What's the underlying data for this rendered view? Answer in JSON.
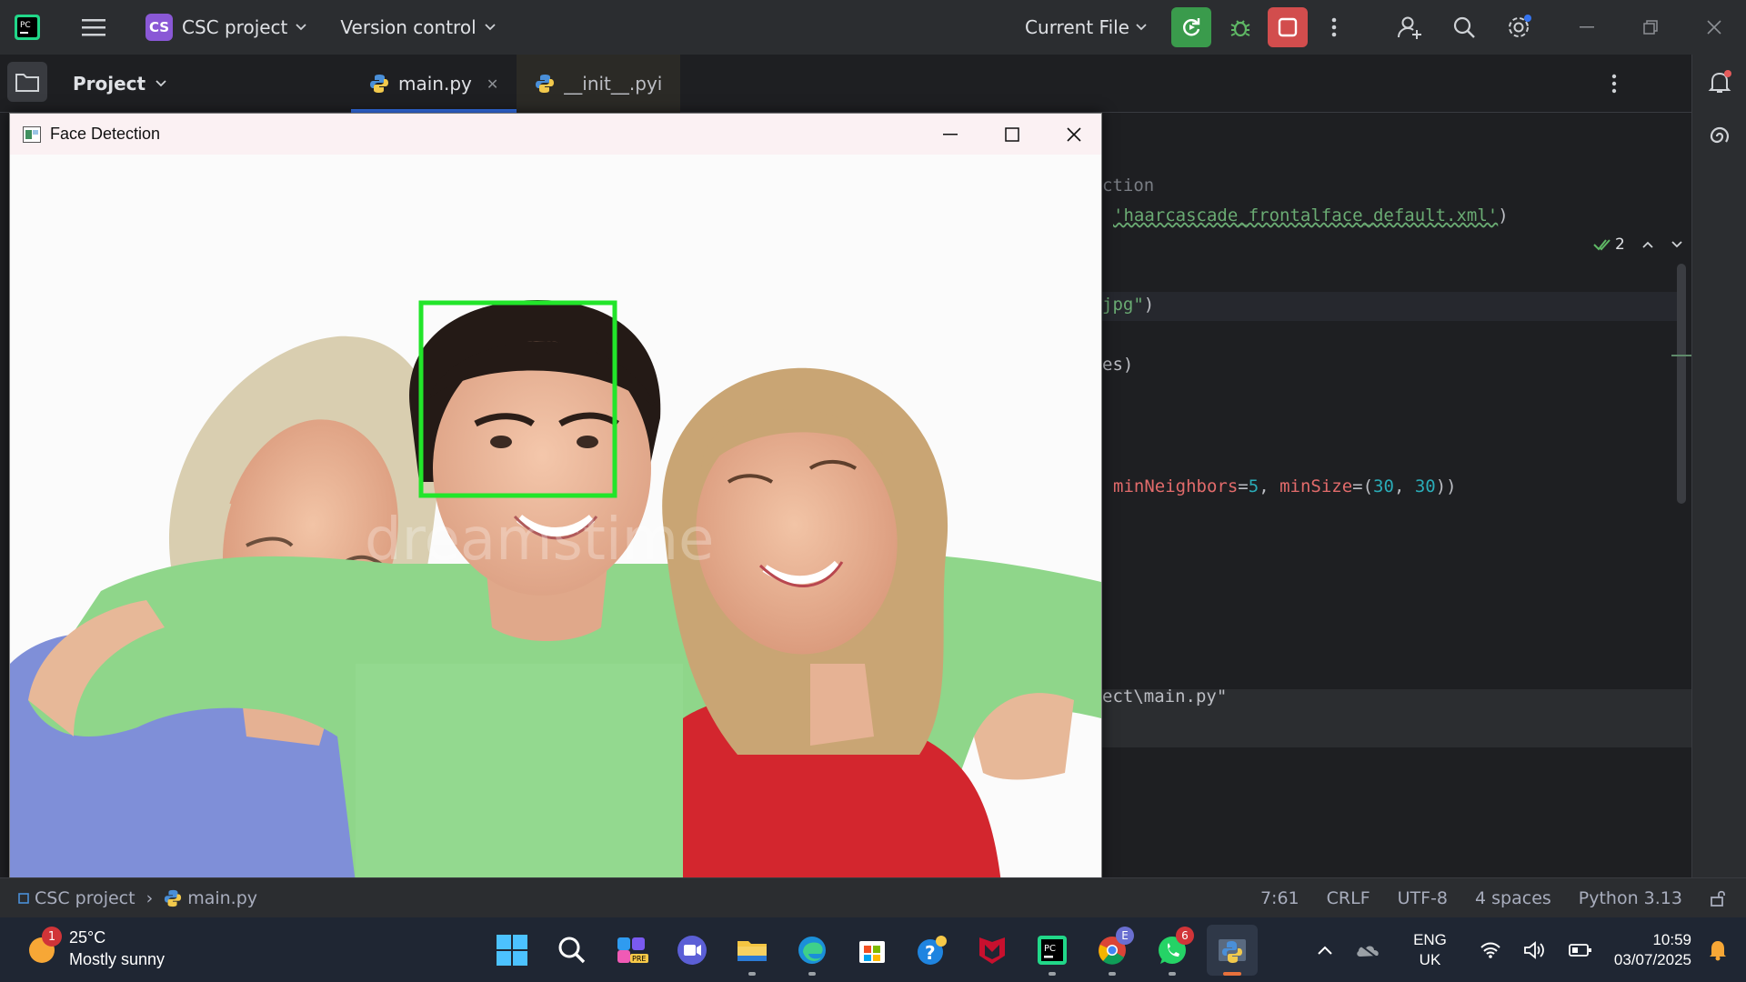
{
  "titlebar": {
    "project_badge": "CS",
    "project_name": "CSC project",
    "vcs_label": "Version control",
    "run_config": "Current File"
  },
  "toolwindow": {
    "project_label": "Project"
  },
  "tabs": [
    {
      "label": "main.py",
      "active": true
    },
    {
      "label": "__init__.pyi",
      "active": false
    }
  ],
  "editor": {
    "inspection_count": "2",
    "lines": [
      {
        "frag": "ction"
      },
      {
        "frag_str": "'haarcascade_frontalface_default.xml'",
        "tail": ")"
      },
      {
        "frag_str": "jpg\"",
        "tail": ")"
      },
      {
        "frag": "es)"
      },
      {
        "kw1": "minNeighbors",
        "n1": "5",
        "kw2": "minSize",
        "n2a": "30",
        "n2b": "30"
      },
      {
        "frag": "ect\\main.py\""
      }
    ]
  },
  "face_window": {
    "title": "Face Detection",
    "watermark": "dreamstime"
  },
  "statusbar": {
    "crumb_project": "CSC project",
    "crumb_file": "main.py",
    "position": "7:61",
    "line_sep": "CRLF",
    "encoding": "UTF-8",
    "indent": "4 spaces",
    "interpreter": "Python 3.13"
  },
  "taskbar": {
    "weather_temp": "25°C",
    "weather_desc": "Mostly sunny",
    "weather_badge": "1",
    "edge_badge": "E",
    "whatsapp_badge": "6",
    "lang_1": "ENG",
    "lang_2": "UK",
    "time": "10:59",
    "date": "03/07/2025"
  }
}
